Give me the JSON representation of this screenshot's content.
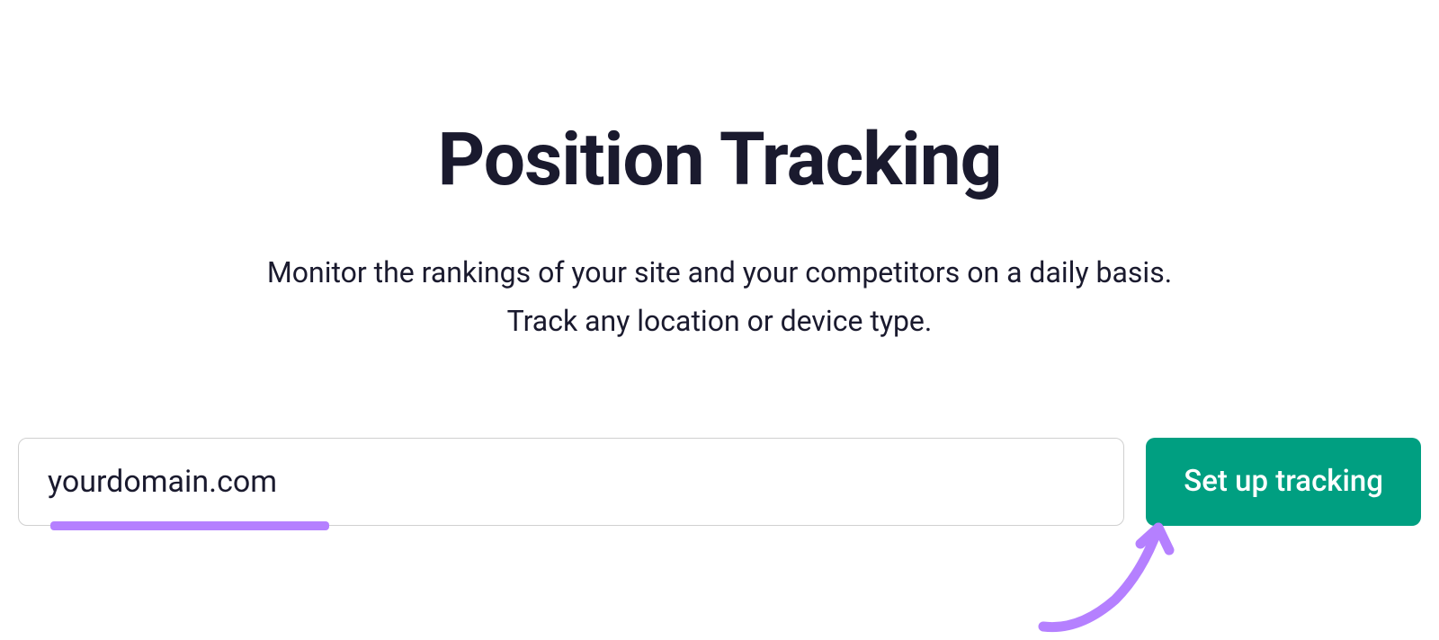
{
  "heading": "Position Tracking",
  "description_line1": "Monitor the rankings of your site and your competitors on a daily basis.",
  "description_line2": "Track any location or device type.",
  "input": {
    "value": "yourdomain.com",
    "placeholder": ""
  },
  "button": {
    "label": "Set up tracking"
  },
  "colors": {
    "accent_green": "#009f81",
    "annotation_purple": "#b580ff",
    "text_dark": "#1a1a2e"
  }
}
